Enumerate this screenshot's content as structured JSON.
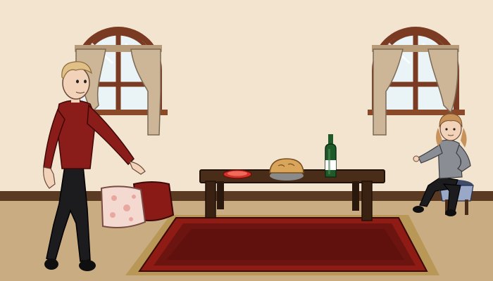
{
  "scene": {
    "palette": {
      "wall": "#f3e4d0",
      "baseboard": "#5a3a22",
      "floor": "#c9ac82",
      "rug_outer": "#8e1c14",
      "rug_inner": "#6b1410",
      "rug_fringe": "#b99756",
      "table_wood": "#4a2d18",
      "curtain": "#cdb597",
      "window_frame": "#7a3b22",
      "glass": "#eaf3f6",
      "sweater": "#8a1d1a",
      "girl_shirt": "#8a8d93",
      "stool": "#404a6a",
      "cushion_pink": "#f4d9d0",
      "cushion_red": "#8a1a16",
      "pie": "#d9a55a",
      "bottle": "#1f5a2a"
    },
    "objects": [
      "left-window",
      "right-window",
      "dining-table",
      "pie",
      "wine-bottle",
      "plate",
      "floor-cushions",
      "rug",
      "man-character",
      "girl-character",
      "stool"
    ]
  }
}
